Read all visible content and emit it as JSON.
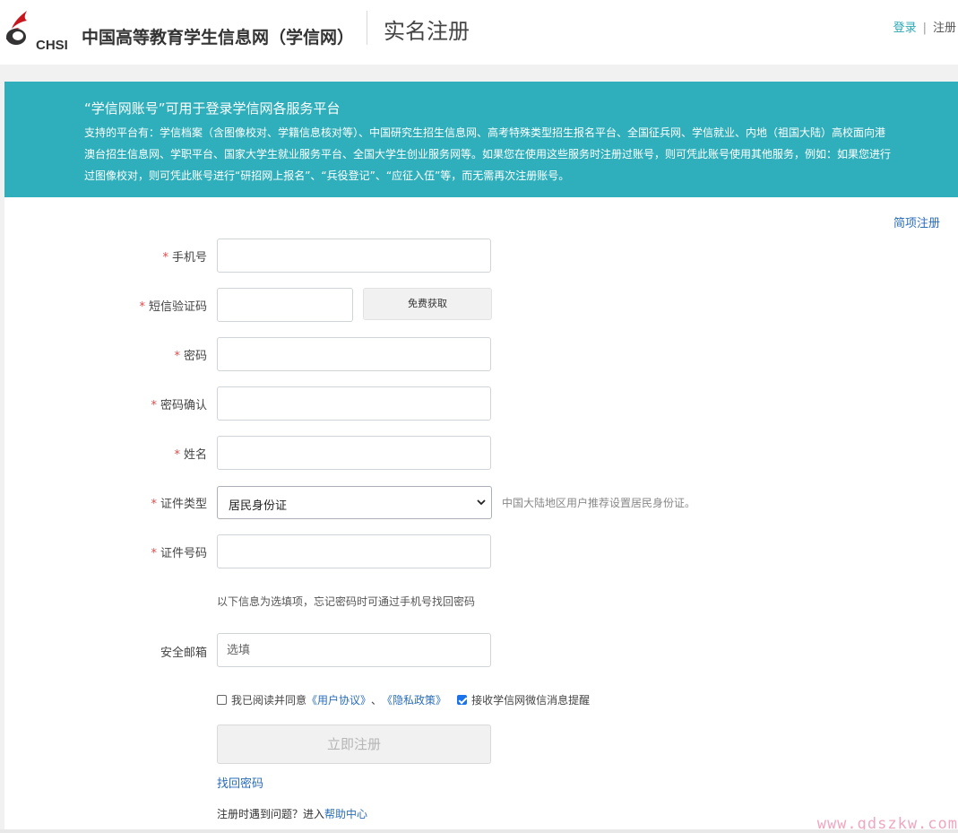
{
  "header": {
    "logo_text": "CHSI",
    "site_name": "中国高等教育学生信息网（学信网）",
    "page_title": "实名注册",
    "login_link": "登录",
    "separator": "|",
    "register_link": "注册"
  },
  "banner": {
    "title": "“学信网账号”可用于登录学信网各服务平台",
    "description": "支持的平台有：学信档案（含图像校对、学籍信息核对等）、中国研究生招生信息网、高考特殊类型招生报名平台、全国征兵网、学信就业、内地（祖国大陆）高校面向港澳台招生信息网、学职平台、国家大学生就业服务平台、全国大学生创业服务网等。如果您在使用这些服务时注册过账号，则可凭此账号使用其他服务，例如：如果您进行过图像校对，则可凭此账号进行“研招网上报名”、“兵役登记”、“应征入伍”等，而无需再次注册账号。"
  },
  "simple_register_link": "简项注册",
  "form": {
    "required_mark": "*",
    "phone_label": "手机号",
    "sms_label": "短信验证码",
    "sms_button": "免费获取",
    "password_label": "密码",
    "password_confirm_label": "密码确认",
    "name_label": "姓名",
    "id_type_label": "证件类型",
    "id_type_value": "居民身份证",
    "id_type_hint": "中国大陆地区用户推荐设置居民身份证。",
    "id_number_label": "证件号码",
    "optional_note": "以下信息为选填项，忘记密码时可通过手机号找回密码",
    "email_label": "安全邮箱",
    "email_placeholder": "选填",
    "agree_text": "我已阅读并同意",
    "user_agreement": "《用户协议》",
    "agree_sep": "、",
    "privacy_policy": "《隐私政策》",
    "agree_checked": false,
    "wechat_text": "接收学信网微信消息提醒",
    "wechat_checked": true,
    "submit_button": "立即注册",
    "find_password": "找回密码",
    "help_text": "注册时遇到问题？进入",
    "help_link": "帮助中心"
  },
  "watermark": "www.gdszkw.com",
  "colors": {
    "banner": "#2fafbb",
    "link": "#2a6dbb",
    "required": "#e24a4a",
    "logo_red": "#c8161d"
  }
}
